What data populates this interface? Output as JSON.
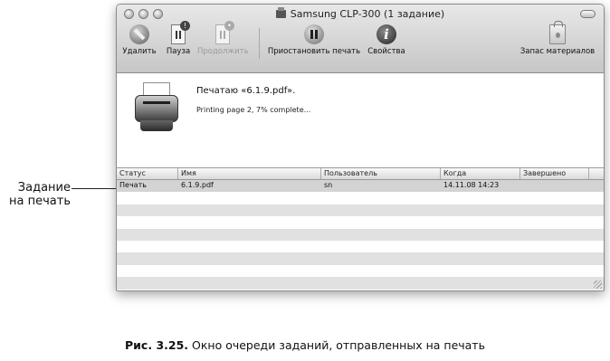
{
  "window": {
    "title": "Samsung CLP-300 (1 задание)"
  },
  "toolbar": {
    "delete_label": "Удалить",
    "pause_label": "Пауза",
    "resume_label": "Продолжить",
    "pause_printing_label": "Приостановить печать",
    "properties_label": "Свойства",
    "supplies_label": "Запас материалов",
    "icons": [
      "stop-icon",
      "document-pause-icon",
      "document-resume-icon",
      "pause-icon",
      "info-icon",
      "shopping-bag-icon"
    ]
  },
  "status": {
    "main": "Печатаю «6.1.9.pdf».",
    "detail": "Printing page 2, 7% complete..."
  },
  "table": {
    "columns": [
      "Статус",
      "Имя",
      "Пользователь",
      "Когда",
      "Завершено"
    ],
    "rows": [
      {
        "status": "Печать",
        "name": "6.1.9.pdf",
        "user": "sn",
        "when": "14.11.08 14:23",
        "done": ""
      }
    ]
  },
  "callout": {
    "text_line1": "Задание",
    "text_line2": "на печать"
  },
  "caption": {
    "prefix": "Рис. 3.25.",
    "text": " Окно очереди заданий, отправленных на печать"
  }
}
